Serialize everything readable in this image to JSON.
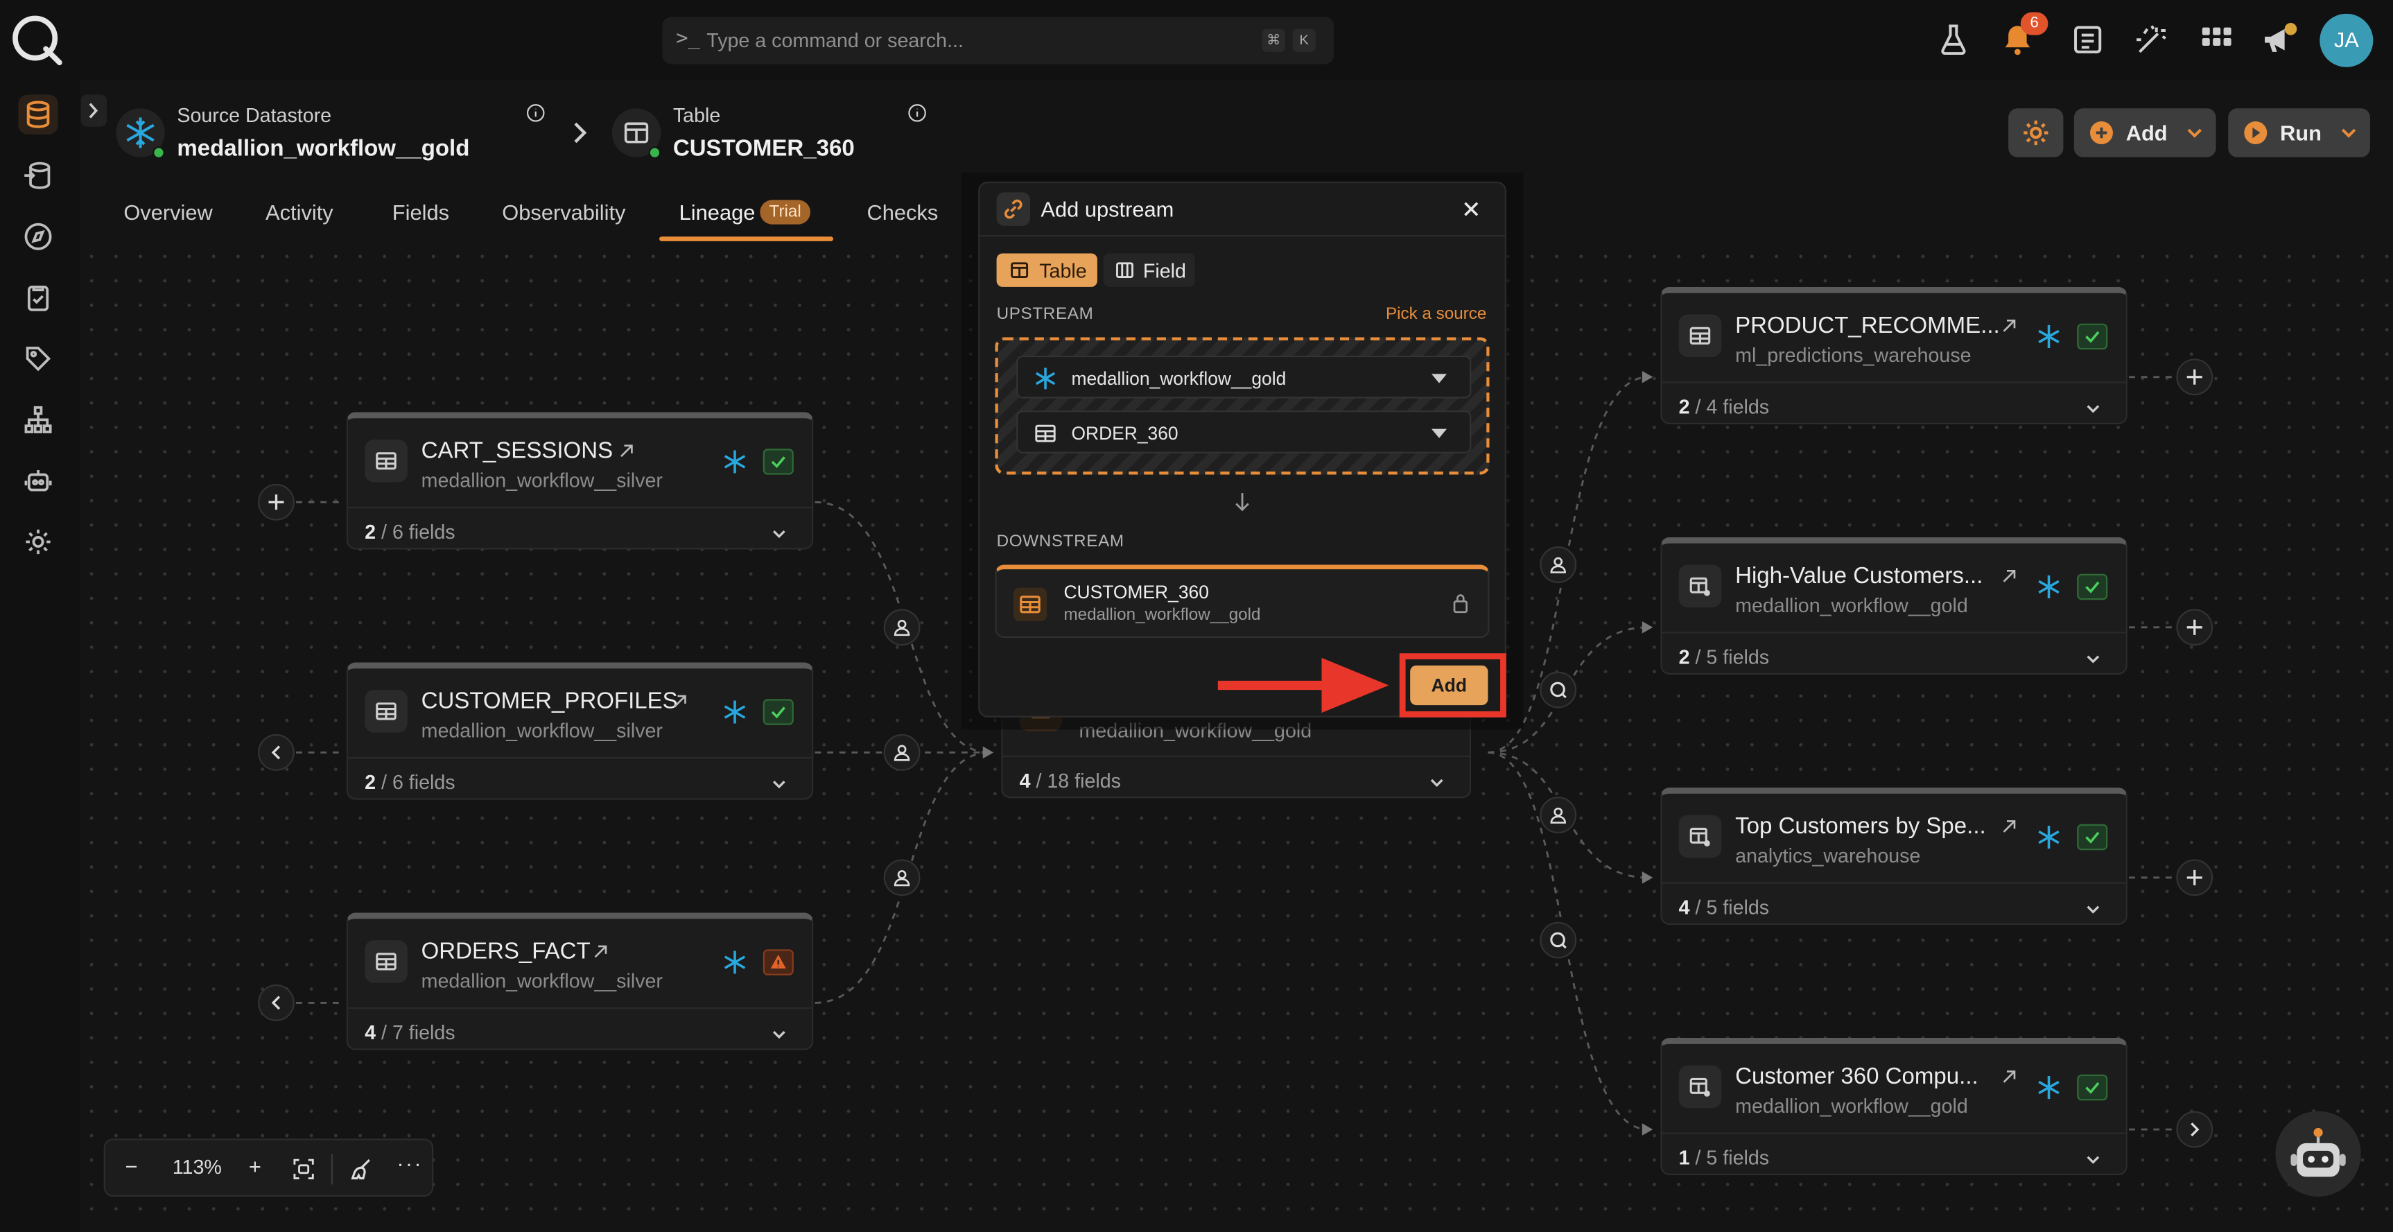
{
  "search": {
    "prompt_glyph": ">_",
    "placeholder": "Type a command or search...",
    "shortcut_mod": "⌘",
    "shortcut_key": "K"
  },
  "topbar": {
    "notification_count": "6",
    "avatar_initials": "JA"
  },
  "breadcrumb": {
    "datastore_label": "Source Datastore",
    "datastore_name": "medallion_workflow__gold",
    "table_label": "Table",
    "table_name": "CUSTOMER_360"
  },
  "tabs": [
    {
      "label": "Overview"
    },
    {
      "label": "Activity"
    },
    {
      "label": "Fields"
    },
    {
      "label": "Observability"
    },
    {
      "label": "Lineage",
      "badge": "Trial"
    },
    {
      "label": "Checks"
    }
  ],
  "header_buttons": {
    "add": "Add",
    "run": "Run"
  },
  "nodes": {
    "cart_sessions": {
      "title": "CART_SESSIONS",
      "store": "medallion_workflow__silver",
      "fields_shown": "2",
      "fields_total": " / 6 fields",
      "status": "ok"
    },
    "customer_profiles": {
      "title": "CUSTOMER_PROFILES",
      "store": "medallion_workflow__silver",
      "fields_shown": "2",
      "fields_total": " / 6 fields",
      "status": "ok"
    },
    "orders_fact": {
      "title": "ORDERS_FACT",
      "store": "medallion_workflow__silver",
      "fields_shown": "4",
      "fields_total": " / 7 fields",
      "status": "warning"
    },
    "center": {
      "store": "medallion_workflow__gold",
      "fields_shown": "4",
      "fields_total": " / 18 fields"
    },
    "product_recomme": {
      "title": "PRODUCT_RECOMME...",
      "store": "ml_predictions_warehouse",
      "fields_shown": "2",
      "fields_total": " / 4 fields",
      "status": "ok"
    },
    "high_value": {
      "title": "High-Value Customers...",
      "store": "medallion_workflow__gold",
      "fields_shown": "2",
      "fields_total": " / 5 fields",
      "status": "ok"
    },
    "top_customers": {
      "title": "Top Customers by Spe...",
      "store": "analytics_warehouse",
      "fields_shown": "4",
      "fields_total": " / 5 fields",
      "status": "ok"
    },
    "customer_360_compu": {
      "title": "Customer 360 Compu...",
      "store": "medallion_workflow__gold",
      "fields_shown": "1",
      "fields_total": " / 5 fields",
      "status": "ok"
    }
  },
  "modal": {
    "title": "Add upstream",
    "segment_table": "Table",
    "segment_field": "Field",
    "upstream_label": "UPSTREAM",
    "pick_source": "Pick a source",
    "upstream_datastore": "medallion_workflow__gold",
    "upstream_table": "ORDER_360",
    "downstream_label": "DOWNSTREAM",
    "downstream_table": "CUSTOMER_360",
    "downstream_store": "medallion_workflow__gold",
    "add_button": "Add"
  },
  "zoom": {
    "minus": "−",
    "level": "113%",
    "plus": "+",
    "more": "···"
  },
  "colors": {
    "accent": "#e88d3a",
    "ok": "#39b54a",
    "warning": "#e0632b",
    "highlight": "#e8372a",
    "snowflake": "#29a8e0"
  }
}
